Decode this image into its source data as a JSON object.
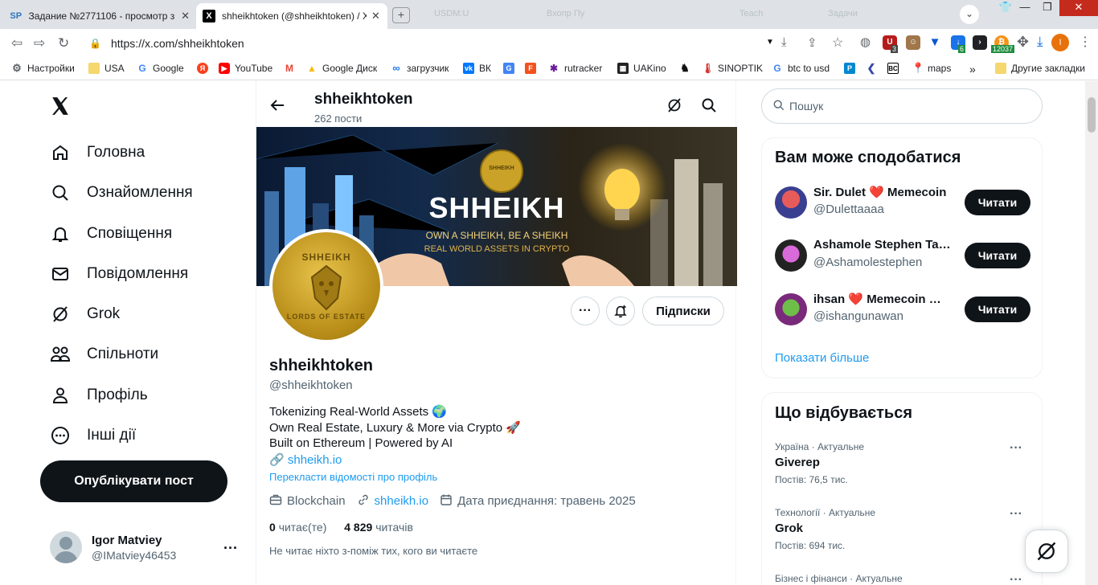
{
  "browser": {
    "tabs": [
      {
        "favicon": "SP",
        "title": "Задание №2771106 - просмотр з",
        "active": false
      },
      {
        "favicon": "X",
        "title": "shheikhtoken (@shheikhtoken) / X",
        "active": true
      }
    ],
    "ghost_tabs": [
      "USDM:U",
      "Вхопр Пу",
      "Teach",
      "Задачи"
    ],
    "url": "https://x.com/shheikhtoken",
    "ext_badges": {
      "b1": "3",
      "b2": "6",
      "b3": "12037"
    },
    "bookmarks": [
      {
        "label": "Настройки",
        "icon": "gear-icon"
      },
      {
        "label": "USA",
        "icon": "folder-icon"
      },
      {
        "label": "Google",
        "icon": "google-icon"
      },
      {
        "label": "",
        "icon": "yandex-icon"
      },
      {
        "label": "YouTube",
        "icon": "youtube-icon"
      },
      {
        "label": "",
        "icon": "gmail-icon"
      },
      {
        "label": "Google Диск",
        "icon": "drive-icon"
      },
      {
        "label": "загрузчик",
        "icon": "infinity-icon"
      },
      {
        "label": "ВК",
        "icon": "vk-icon"
      },
      {
        "label": "",
        "icon": "translate-icon"
      },
      {
        "label": "",
        "icon": "f-icon"
      },
      {
        "label": "rutracker",
        "icon": "rutracker-icon"
      },
      {
        "label": "UAKino",
        "icon": "uakino-icon"
      },
      {
        "label": "",
        "icon": "chess-icon"
      },
      {
        "label": "SINOPTIK",
        "icon": "thermometer-icon"
      },
      {
        "label": "btc to usd",
        "icon": "google-icon"
      },
      {
        "label": "",
        "icon": "p-icon"
      },
      {
        "label": "",
        "icon": "arrow-icon"
      },
      {
        "label": "",
        "icon": "bc-icon"
      },
      {
        "label": "maps",
        "icon": "maps-icon"
      }
    ],
    "bookmarks_overflow": "»",
    "other_bookmarks": "Другие закладки"
  },
  "sidebar": {
    "logo": "X",
    "items": [
      {
        "label": "Головна",
        "icon": "home-icon"
      },
      {
        "label": "Ознайомлення",
        "icon": "search-icon"
      },
      {
        "label": "Сповіщення",
        "icon": "bell-icon"
      },
      {
        "label": "Повідомлення",
        "icon": "mail-icon"
      },
      {
        "label": "Grok",
        "icon": "grok-icon"
      },
      {
        "label": "Спільноти",
        "icon": "communities-icon"
      },
      {
        "label": "Профіль",
        "icon": "profile-icon"
      },
      {
        "label": "Інші дії",
        "icon": "more-icon"
      }
    ],
    "post_button": "Опублікувати пост",
    "account": {
      "name": "Igor Matviey",
      "handle": "@IMatviey46453"
    }
  },
  "profile": {
    "header_title": "shheikhtoken",
    "header_posts": "262 пости",
    "banner": {
      "title": "SHHEIKH",
      "line1": "OWN A SHHEIKH, BE A SHEIKH",
      "line2": "REAL WORLD ASSETS IN CRYPTO",
      "coin_text": "SHHEIKH"
    },
    "avatar": {
      "top_text": "SHHEIKH",
      "bottom_text": "LORDS OF ESTATE"
    },
    "follow_button": "Підписки",
    "name": "shheikhtoken",
    "handle": "@shheikhtoken",
    "bio": [
      "Tokenizing Real-World Assets 🌍",
      "Own Real Estate, Luxury & More via Crypto 🚀",
      "Built on Ethereum | Powered by AI"
    ],
    "bio_link": "shheikh.io",
    "translate": "Перекласти відомості про профіль",
    "category": "Blockchain",
    "website": "shheikh.io",
    "joined": "Дата приєднання: травень 2025",
    "following_count": "0",
    "following_label": "читає(те)",
    "followers_count": "4 829",
    "followers_label": "читачів",
    "no_common": "Не читає ніхто з-поміж тих, кого ви читаєте"
  },
  "right": {
    "search_placeholder": "Пошук",
    "suggestions_title": "Вам може сподобатися",
    "suggestions": [
      {
        "name": "Sir. Dulet ❤️ Memecoin",
        "handle": "@Dulettaaaa",
        "button": "Читати"
      },
      {
        "name": "Ashamole Stephen Taba…",
        "handle": "@Ashamolestephen",
        "button": "Читати"
      },
      {
        "name": "ihsan ❤️ Memecoin …",
        "handle": "@ishangunawan",
        "button": "Читати"
      }
    ],
    "show_more": "Показати більше",
    "trends_title": "Що відбувається",
    "trends": [
      {
        "context": "Україна · Актуальне",
        "title": "Giverep",
        "count": "Постів: 76,5 тис."
      },
      {
        "context": "Технології · Актуальне",
        "title": "Grok",
        "count": "Постів: 694 тис."
      },
      {
        "context": "Бізнес і фінанси · Актуальне",
        "title": "",
        "count": ""
      }
    ]
  }
}
